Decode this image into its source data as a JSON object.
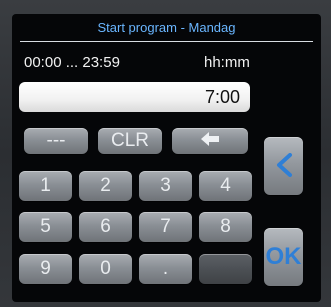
{
  "window": {
    "title": "Start program - Mandag"
  },
  "range_text": "00:00 ... 23:59",
  "format_text": "hh:mm",
  "time_input": {
    "value": "7:00"
  },
  "keypad": {
    "dash_label": "---",
    "clear_label": "CLR",
    "backspace_icon": "backspace-arrow-icon",
    "keys": [
      "1",
      "2",
      "3",
      "4",
      "5",
      "6",
      "7",
      "8",
      "9",
      "0",
      "."
    ],
    "back_icon": "chevron-left-icon",
    "ok_label": "OK"
  },
  "colors": {
    "accent": "#2f7fd6",
    "title": "#6ab6ff"
  }
}
